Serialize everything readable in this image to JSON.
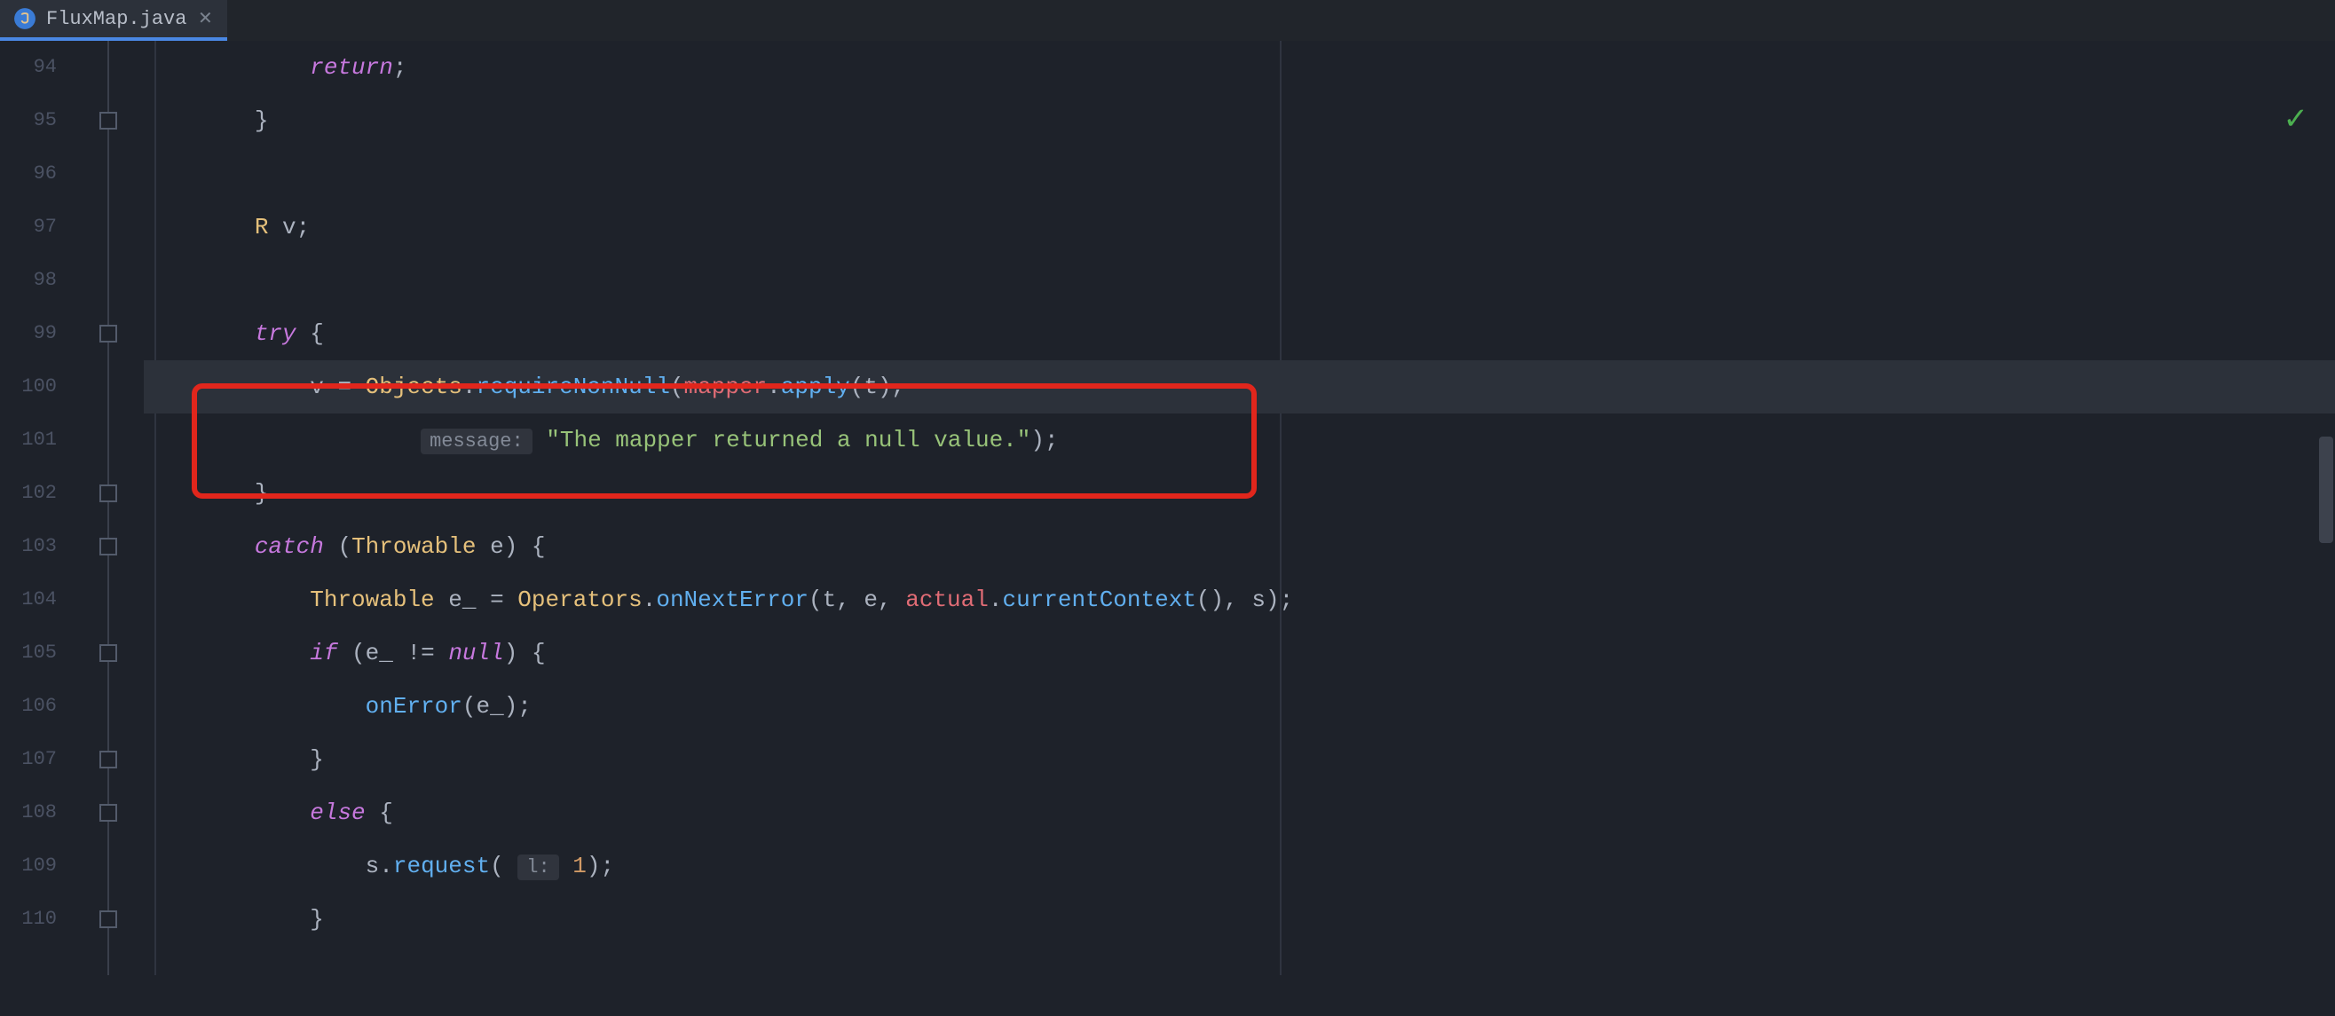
{
  "tab": {
    "filename": "FluxMap.java"
  },
  "status": {
    "ok_icon": "✓"
  },
  "gutter": {
    "lines": [
      "94",
      "95",
      "96",
      "97",
      "98",
      "99",
      "100",
      "101",
      "102",
      "103",
      "104",
      "105",
      "106",
      "107",
      "108",
      "109",
      "110"
    ]
  },
  "code": {
    "l94_return": "return",
    "l94_semi": ";",
    "l95_brace": "}",
    "l97_type": "R",
    "l97_var": " v;",
    "l99_try": "try",
    "l99_brace": " {",
    "l100_lhs": "v = ",
    "l100_objects": "Objects",
    "l100_dot1": ".",
    "l100_req": "requireNonNull",
    "l100_p1": "(",
    "l100_mapper": "mapper",
    "l100_dot2": ".",
    "l100_apply": "apply",
    "l100_p2": "(",
    "l100_t": "t",
    "l100_close": "),",
    "l101_hint": "message:",
    "l101_str": "\"The mapper returned a null value.\"",
    "l101_close": ");",
    "l102_brace": "}",
    "l103_catch": "catch",
    "l103_open": " (",
    "l103_throwable": "Throwable",
    "l103_e": " e",
    "l103_close": ") {",
    "l104_throwable": "Throwable",
    "l104_evar": " e_ = ",
    "l104_ops": "Operators",
    "l104_dot": ".",
    "l104_onNext": "onNextError",
    "l104_open": "(",
    "l104_t": "t",
    "l104_c1": ", ",
    "l104_e": "e",
    "l104_c2": ", ",
    "l104_actual": "actual",
    "l104_dot2": ".",
    "l104_cc": "currentContext",
    "l104_cc_close": "()",
    "l104_c3": ", ",
    "l104_s": "s",
    "l104_close": ");",
    "l105_if": "if",
    "l105_open": " (",
    "l105_e": "e_",
    "l105_neq": " != ",
    "l105_null": "null",
    "l105_close": ") {",
    "l106_onerr": "onError",
    "l106_open": "(",
    "l106_e": "e_",
    "l106_close": ");",
    "l107_brace": "}",
    "l108_else": "else",
    "l108_brace": " {",
    "l109_s": "s",
    "l109_dot": ".",
    "l109_req": "request",
    "l109_open": "(",
    "l109_hint": "l:",
    "l109_one": " 1",
    "l109_close": ");",
    "l110_brace": "}"
  }
}
